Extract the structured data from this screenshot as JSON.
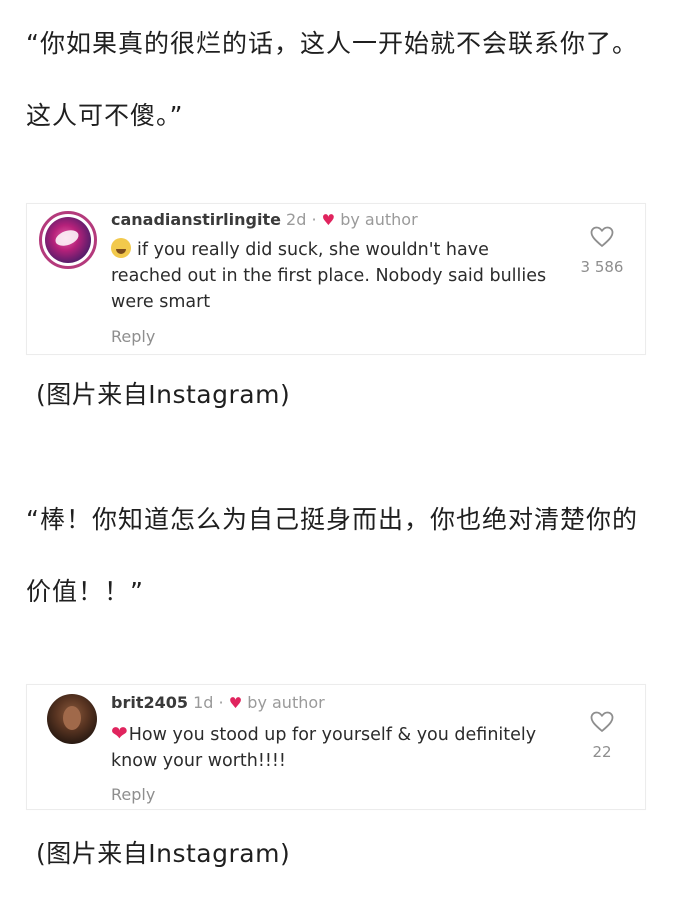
{
  "post1": {
    "quote": "“你如果真的很烂的话，这人一开始就不会联系你了。这人可不傻。”",
    "comment": {
      "username": "canadianstirlingite",
      "time": "2d",
      "separator": "·",
      "liked_by": "by author",
      "emoji": "laughing-emoji",
      "text": "if you really did suck, she wouldn't have reached out in the first place. Nobody said bullies were smart",
      "reply_label": "Reply",
      "like_count": "3 586"
    },
    "caption": "(图片来自Instagram)"
  },
  "post2": {
    "quote": "“棒！你知道怎么为自己挺身而出，你也绝对清楚你的价值！！”",
    "comment": {
      "username": "brit2405",
      "time": "1d",
      "separator": "·",
      "liked_by": "by author",
      "emoji": "red-heart-emoji",
      "text": "How you stood up for yourself & you definitely know your worth!!!!",
      "reply_label": "Reply",
      "like_count": "22"
    },
    "caption": "(图片来自Instagram)"
  },
  "colors": {
    "heart": "#e0245e",
    "muted_text": "#8e8e8e",
    "body_text": "#1f1f1f"
  }
}
